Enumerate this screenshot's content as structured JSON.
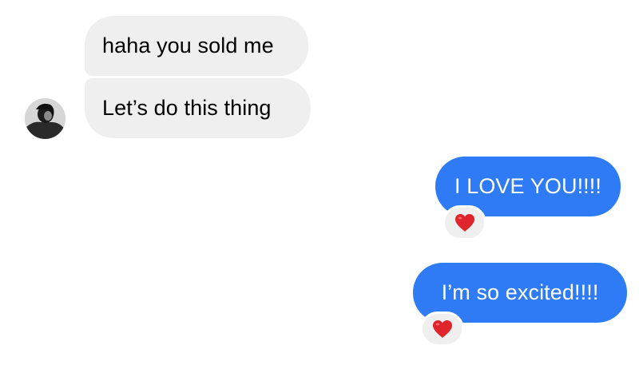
{
  "colors": {
    "received_bubble": "#efefef",
    "sent_bubble": "#2f7bf6",
    "heart": "#e0242b"
  },
  "conversation": {
    "received": [
      {
        "text": "haha you sold me"
      },
      {
        "text": "Let’s do this thing"
      }
    ],
    "sent": [
      {
        "text": "I LOVE YOU!!!!",
        "reaction": "heart-icon"
      },
      {
        "text": "I’m so excited!!!!",
        "reaction": "heart-icon"
      }
    ]
  }
}
